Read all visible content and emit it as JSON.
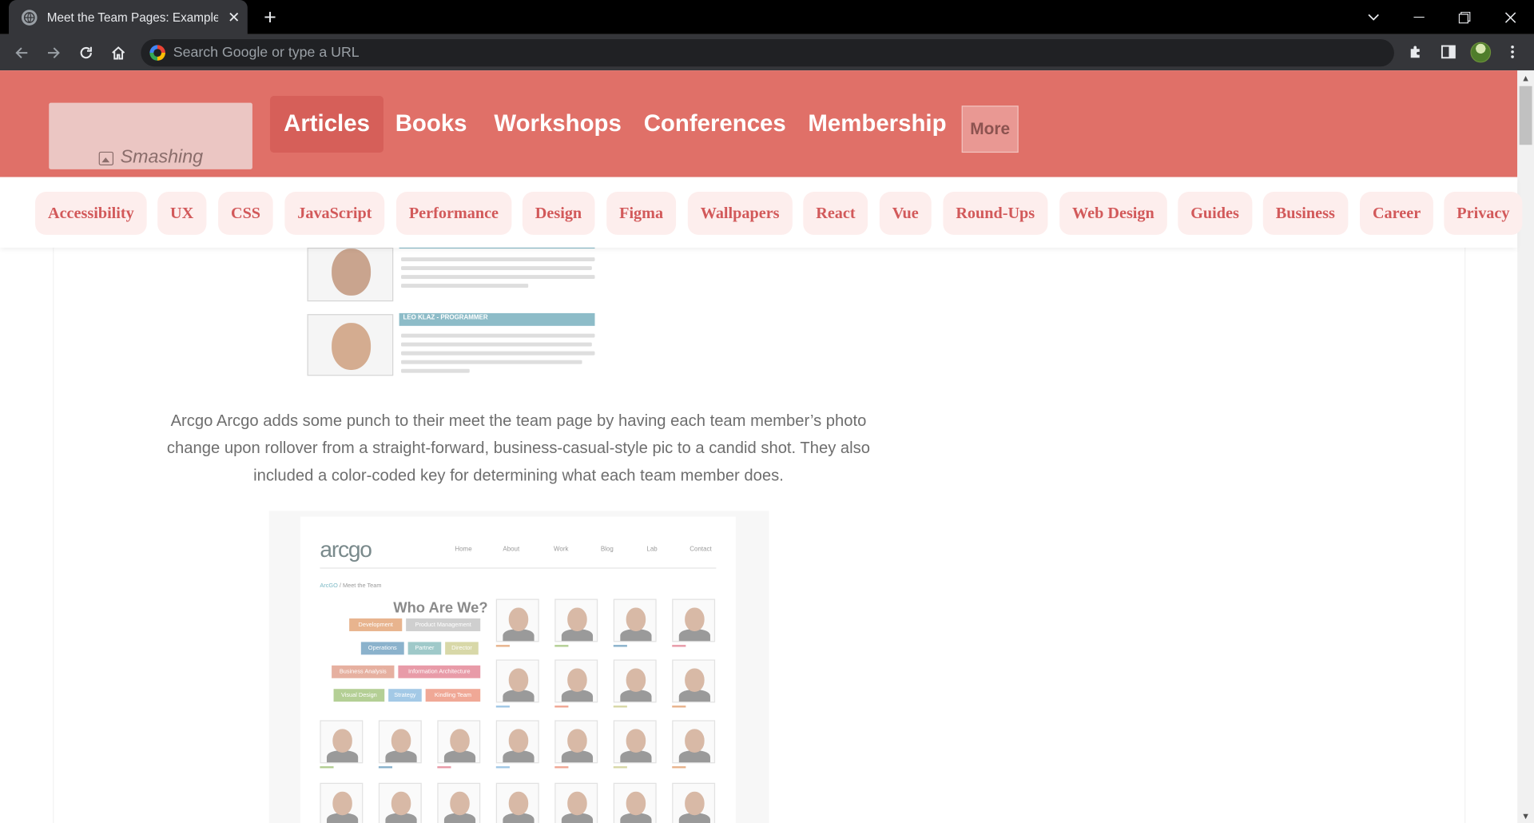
{
  "browser": {
    "tab_title": "Meet the Team Pages: Examples and Best Practices",
    "new_tab_icon": "plus-icon",
    "omnibox_placeholder": "Search Google or type a URL"
  },
  "site": {
    "logo_alt": "Smashing",
    "nav": [
      "Articles",
      "Books",
      "Workshops",
      "Conferences",
      "Membership"
    ],
    "more_label": "More",
    "topics": [
      "Accessibility",
      "UX",
      "CSS",
      "JavaScript",
      "Performance",
      "Design",
      "Figma",
      "Wallpapers",
      "React",
      "Vue",
      "Round-Ups",
      "Web Design",
      "Guides",
      "Business",
      "Career",
      "Privacy"
    ]
  },
  "article": {
    "paragraph": "Arcgo Arcgo adds some punch to their meet the team page by having each team member’s photo change upon rollover from a straight-forward, business-casual-style pic to a candid shot. They also included a color-coded key for determining what each team member does.",
    "team_shot": {
      "member2_title": "LEO KLAZ - PROGRAMMER"
    },
    "arcgo_shot": {
      "logo": "arcgo",
      "nav": [
        "Home",
        "About",
        "Work",
        "Blog",
        "Lab",
        "Contact"
      ],
      "crumb_link": "ArcGO",
      "crumb_rest": " / Meet the Team",
      "heading": "Who Are We?",
      "tags": [
        {
          "label": "Development",
          "color": "#e8b48e"
        },
        {
          "label": "Product Management",
          "color": "#cfcfcf"
        },
        {
          "label": "Operations",
          "color": "#8bb2cc"
        },
        {
          "label": "Partner",
          "color": "#9fc9c9"
        },
        {
          "label": "Director",
          "color": "#d8d8a8"
        },
        {
          "label": "Business Analysis",
          "color": "#e6b0a0"
        },
        {
          "label": "Information Architecture",
          "color": "#e89ba8"
        },
        {
          "label": "Visual Design",
          "color": "#b4cf95"
        },
        {
          "label": "Strategy",
          "color": "#a3c9e6"
        },
        {
          "label": "Kindling Team",
          "color": "#f0a896"
        }
      ]
    }
  }
}
